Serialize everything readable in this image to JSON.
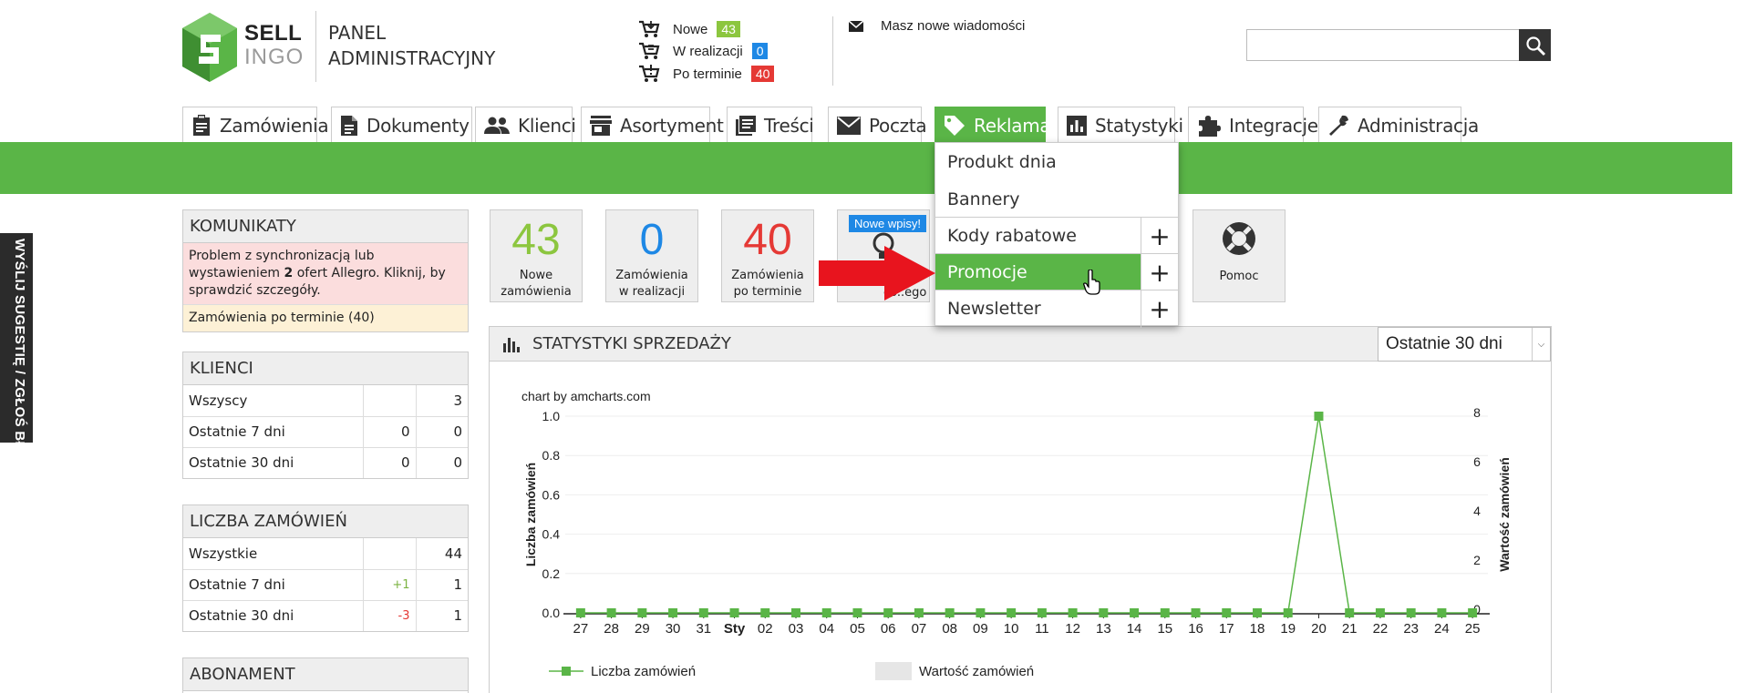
{
  "header": {
    "logo_sell": "SELL",
    "logo_ingo": "INGO",
    "panel_title_line1": "PANEL",
    "panel_title_line2": "ADMINISTRACYJNY",
    "order_statuses": [
      {
        "label": "Nowe",
        "count": "43",
        "color": "#8cc63f"
      },
      {
        "label": "W realizacji",
        "count": "0",
        "color": "#1e88e5"
      },
      {
        "label": "Po terminie",
        "count": "40",
        "color": "#e53935"
      }
    ],
    "messages_text": "Masz nowe wiadomości",
    "search_placeholder": ""
  },
  "nav": {
    "tabs": [
      {
        "label": "Zamówienia",
        "icon": "clipboard-icon"
      },
      {
        "label": "Dokumenty",
        "icon": "document-icon"
      },
      {
        "label": "Klienci",
        "icon": "people-icon"
      },
      {
        "label": "Asortyment",
        "icon": "store-icon"
      },
      {
        "label": "Treści",
        "icon": "articles-icon"
      },
      {
        "label": "Poczta",
        "icon": "mail-icon"
      },
      {
        "label": "Reklama",
        "icon": "tag-icon",
        "active": true
      },
      {
        "label": "Statystyki",
        "icon": "bar-chart-icon"
      },
      {
        "label": "Integracje",
        "icon": "puzzle-icon"
      },
      {
        "label": "Administracja",
        "icon": "wrench-icon"
      }
    ]
  },
  "dropdown": {
    "items": [
      {
        "label": "Produkt dnia",
        "plus": false
      },
      {
        "label": "Bannery",
        "plus": false
      },
      {
        "label": "Kody rabatowe",
        "plus": true
      },
      {
        "label": "Promocje",
        "plus": true,
        "active": true
      },
      {
        "label": "Newsletter",
        "plus": true
      }
    ],
    "plus_symbol": "+"
  },
  "side_tab": "WYŚLIJ SUGESTIĘ / ZGŁOŚ BŁĄD",
  "komunikaty": {
    "title": "KOMUNIKATY",
    "alert1_pre": "Problem z synchronizacją lub wystawieniem ",
    "alert1_bold": "2",
    "alert1_post": " ofert Allegro. Kliknij, by sprawdzić szczegóły.",
    "alert2": "Zamówienia po terminie (40)"
  },
  "klienci": {
    "title": "KLIENCI",
    "rows": [
      {
        "label": "Wszyscy",
        "c2": "",
        "c3": "3"
      },
      {
        "label": "Ostatnie 7 dni",
        "c2": "0",
        "c3": "0"
      },
      {
        "label": "Ostatnie 30 dni",
        "c2": "0",
        "c3": "0"
      }
    ]
  },
  "liczba_zamowien": {
    "title": "LICZBA ZAMÓWIEŃ",
    "rows": [
      {
        "label": "Wszystkie",
        "c2": "",
        "c3": "44"
      },
      {
        "label": "Ostatnie 7 dni",
        "c2": "+1",
        "c3": "1"
      },
      {
        "label": "Ostatnie 30 dni",
        "c2": "-3",
        "c3": "1"
      }
    ]
  },
  "abonament": {
    "title": "ABONAMENT"
  },
  "tiles": [
    {
      "num": "43",
      "line1": "Nowe",
      "line2": "zamówienia",
      "color": "#8cc63f"
    },
    {
      "num": "0",
      "line1": "Zamówienia",
      "line2": "w realizacji",
      "color": "#1e88e5"
    },
    {
      "num": "40",
      "line1": "Zamówienia",
      "line2": "po terminie",
      "color": "#e53935"
    }
  ],
  "tile_partial": {
    "badge": "Nowe wpisy!",
    "label": "co..ego"
  },
  "tile_help": {
    "label": "Pomoc"
  },
  "stats": {
    "title": "STATYSTYKI SPRZEDAŻY",
    "range": "Ostatnie 30 dni"
  },
  "chart_data": {
    "type": "line",
    "credit": "chart by amcharts.com",
    "x": [
      "27",
      "28",
      "29",
      "30",
      "31",
      "Sty",
      "02",
      "03",
      "04",
      "05",
      "06",
      "07",
      "08",
      "09",
      "10",
      "11",
      "12",
      "13",
      "14",
      "15",
      "16",
      "17",
      "18",
      "19",
      "20",
      "21",
      "22",
      "23",
      "24",
      "25"
    ],
    "series": [
      {
        "name": "Liczba zamówień",
        "axis": "left",
        "values": [
          0,
          0,
          0,
          0,
          0,
          0,
          0,
          0,
          0,
          0,
          0,
          0,
          0,
          0,
          0,
          0,
          0,
          0,
          0,
          0,
          0,
          0,
          0,
          0,
          1,
          0,
          0,
          0,
          0,
          0
        ],
        "color": "#5ab547"
      },
      {
        "name": "Wartość zamówień",
        "axis": "right",
        "values": [],
        "color": "#e6e6e6"
      }
    ],
    "ylabel": "Liczba zamówień",
    "y2label": "Wartość zamówień",
    "yticks": [
      "0.0",
      "0.2",
      "0.4",
      "0.6",
      "0.8",
      "1.0"
    ],
    "y2ticks": [
      "0",
      "2",
      "4",
      "6",
      "8"
    ],
    "ylim": [
      0,
      1
    ],
    "y2lim": [
      0,
      8
    ],
    "legend": "bottom"
  }
}
